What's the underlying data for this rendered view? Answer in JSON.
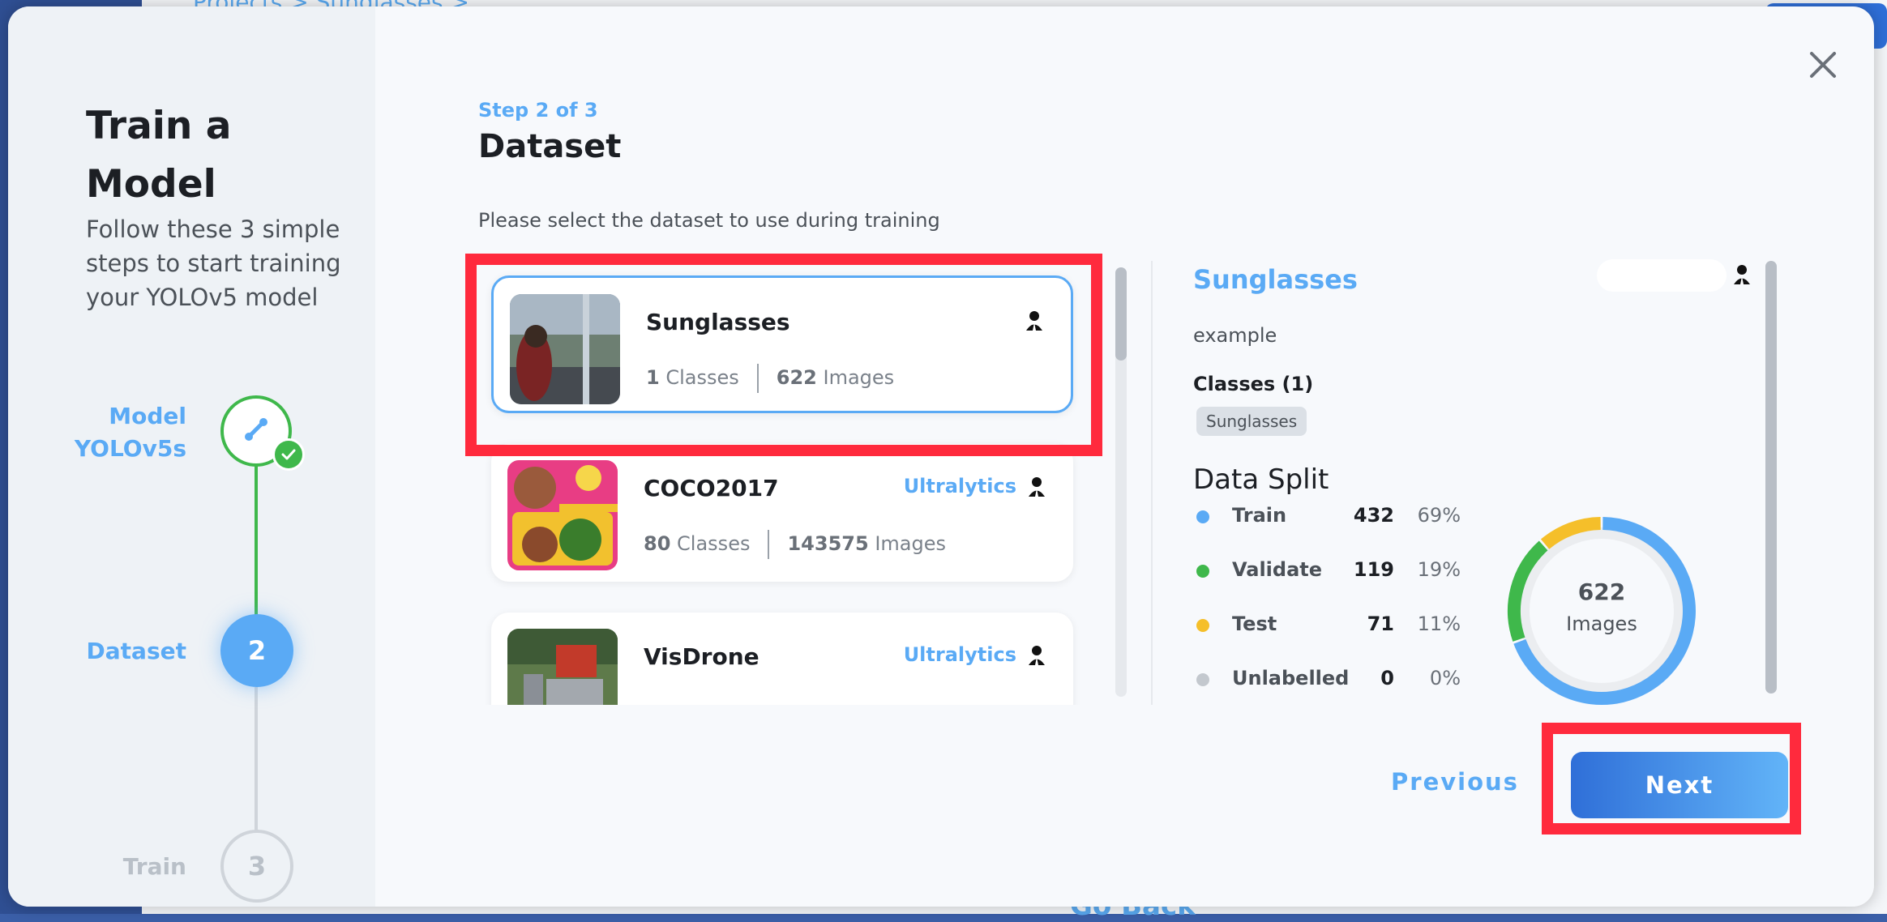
{
  "background": {
    "breadcrumb": "Projects  >  Sunglasses  >",
    "go_back": "Go Back"
  },
  "modal": {
    "title": "Train a Model",
    "subtitle": "Follow these 3 simple steps to start training your YOLOv5 model",
    "steps": [
      {
        "label": "Model\nYOLOv5s",
        "number": "",
        "state": "complete"
      },
      {
        "label": "Dataset",
        "number": "2",
        "state": "active"
      },
      {
        "label": "Train",
        "number": "3",
        "state": "upcoming"
      }
    ],
    "step_tag": "Step 2 of 3",
    "page_title": "Dataset",
    "page_desc": "Please select the dataset to use during training",
    "datasets": [
      {
        "name": "Sunglasses",
        "owner": "",
        "classes": "1",
        "classes_label": "Classes",
        "images": "622",
        "images_label": "Images",
        "selected": true
      },
      {
        "name": "COCO2017",
        "owner": "Ultralytics",
        "classes": "80",
        "classes_label": "Classes",
        "images": "143575",
        "images_label": "Images",
        "selected": false
      },
      {
        "name": "VisDrone",
        "owner": "Ultralytics",
        "classes": "",
        "classes_label": "",
        "images": "",
        "images_label": "",
        "selected": false
      }
    ],
    "details": {
      "name": "Sunglasses",
      "description": "example",
      "classes_heading": "Classes (1)",
      "class_chips": [
        "Sunglasses"
      ],
      "split_heading": "Data Split",
      "split": [
        {
          "label": "Train",
          "count": "432",
          "percent": "69%",
          "color": "#5aaaf5",
          "fraction": 0.695
        },
        {
          "label": "Validate",
          "count": "119",
          "percent": "19%",
          "color": "#3fb84b",
          "fraction": 0.191
        },
        {
          "label": "Test",
          "count": "71",
          "percent": "11%",
          "color": "#f5bf2a",
          "fraction": 0.114
        },
        {
          "label": "Unlabelled",
          "count": "0",
          "percent": "0%",
          "color": "#c3c8ce",
          "fraction": 0
        }
      ],
      "total": "622",
      "total_label": "Images"
    },
    "buttons": {
      "previous": "Previous",
      "next": "Next"
    }
  },
  "icons": {
    "close": "close-icon",
    "model_step": "link-icon",
    "check": "check-icon",
    "owner": "user-icon"
  }
}
